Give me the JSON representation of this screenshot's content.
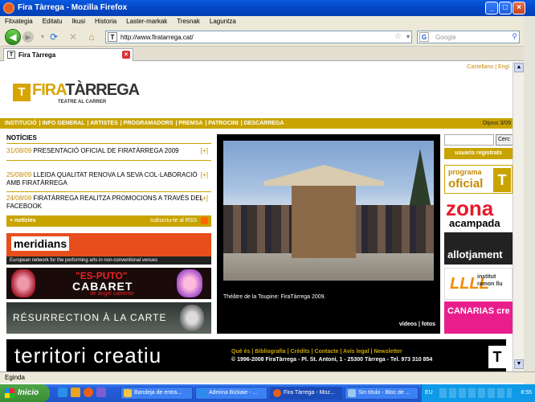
{
  "window": {
    "title": "Fira Tàrrega - Mozilla Firefox"
  },
  "menu": [
    "Fitxategia",
    "Editatu",
    "Ikusi",
    "Historia",
    "Laster-markak",
    "Tresnak",
    "Laguntza"
  ],
  "toolbar": {
    "url": "http://www.firatarrega.cat/",
    "search_placeholder": "Google"
  },
  "tabs": [
    {
      "label": "Fira Tàrrega"
    }
  ],
  "page": {
    "langs": "Castellano  |  Engl",
    "logo": {
      "fira": "FIRA",
      "tarrega": "TÀRREGA",
      "sub": "TEATRE AL CARRER"
    },
    "nav": [
      "INSTITUCIÓ",
      "INFO GENERAL",
      "ARTISTES",
      "PROGRAMADORS",
      "PREMSA",
      "PATROCINI",
      "DESCÀRREGA"
    ],
    "date": "Dijous 3/09",
    "news_title": "NOTÍCIES",
    "news": [
      {
        "date": "31/08/09",
        "text": "PRESENTACIÓ OFICIAL DE FIRATÀRREGA 2009",
        "plus": "[+]"
      },
      {
        "date": "25/08/09",
        "text": "LLEIDA QUALITAT RENOVA LA SEVA COL·LABORACIÓ AMB FIRATÀRREGA",
        "plus": "[+]"
      },
      {
        "date": "24/08/09",
        "text": "FIRATÀRREGA REALITZA PROMOCIONS A TRAVÉS DEL FACEBOOK",
        "plus": "[+]"
      }
    ],
    "news_more": "+ notícies",
    "rss": "subscriu-te al RSS",
    "banners": {
      "meridians": "meridians",
      "meridians_sub": "European network for the performing arts in non-conventional venues",
      "cabaret1": "\"ES-PUTO\"",
      "cabaret2": "CABARET",
      "cabaret3": "de àngel calvente",
      "resurrection": "RÉSURRECTION À LA CARTE"
    },
    "photo_caption": "Théâtre de la Toupine: FiraTàrrega 2009.",
    "photo_links": "vídeos  |  fotos",
    "search_btn": "Cerc",
    "registered": "usuaris registrats",
    "right_banners": {
      "prog_a": "programa",
      "prog_b": "oficial",
      "zona_a": "zona",
      "zona_b": "acampada",
      "allot": "allotjament",
      "ramon_a": "LLLL",
      "ramon_b": "institut\nramon llu",
      "canarias": "CANARIAS cre"
    },
    "footer": {
      "big": "territori creatiu",
      "links": "Què és | Bibliografia | Crèdits | Contacte | Avís legal | Newsletter",
      "copy": "© 1996-2008 FiraTàrrega - Pl. St. Antoni, 1 - 25300 Tàrrega - Tel. 973 310 854"
    }
  },
  "status": "Egindа",
  "taskbar": {
    "start": "Inicio",
    "tasks": [
      "Bandeja de entra...",
      "Admina Bizkaie - ...",
      "Fira Tàrrega - Moz...",
      "Sin título - Bloc de ..."
    ],
    "lang": "EU",
    "clock": "8:55"
  },
  "colors": {
    "accent": "#c9a400",
    "xp_blue": "#0447c6"
  }
}
